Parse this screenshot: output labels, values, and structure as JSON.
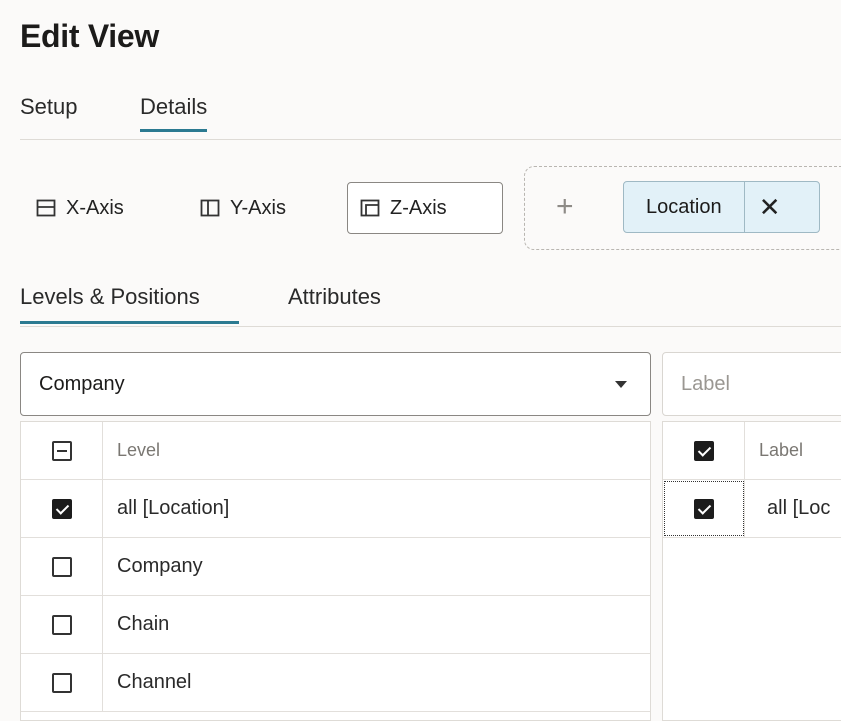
{
  "page": {
    "title": "Edit View"
  },
  "tabs": [
    {
      "label": "Setup",
      "active": false
    },
    {
      "label": "Details",
      "active": true
    }
  ],
  "axis_buttons": [
    {
      "label": "X-Axis",
      "icon": "x-axis-icon",
      "selected": false
    },
    {
      "label": "Y-Axis",
      "icon": "y-axis-icon",
      "selected": false
    },
    {
      "label": "Z-Axis",
      "icon": "z-axis-icon",
      "selected": true
    }
  ],
  "drop_zone": {
    "add_icon": "plus-icon",
    "chips": [
      {
        "label": "Location",
        "remove_icon": "close-icon"
      }
    ]
  },
  "subtabs": [
    {
      "label": "Levels & Positions",
      "active": true
    },
    {
      "label": "Attributes",
      "active": false
    }
  ],
  "hierarchy_select": {
    "value": "Company",
    "icon": "chevron-down-icon"
  },
  "levels_table": {
    "header": {
      "label": "Level",
      "checkbox": "indeterminate"
    },
    "rows": [
      {
        "label": "all [Location]",
        "checked": true
      },
      {
        "label": "Company",
        "checked": false
      },
      {
        "label": "Chain",
        "checked": false
      },
      {
        "label": "Channel",
        "checked": false
      }
    ]
  },
  "label_filter": {
    "placeholder": "Label"
  },
  "labels_table": {
    "header": {
      "label": "Label",
      "checked": true
    },
    "rows": [
      {
        "label": "all [Loc",
        "checked": true
      }
    ]
  },
  "colors": {
    "accent": "#2b7a91",
    "chip_bg": "#e2f1f8"
  }
}
